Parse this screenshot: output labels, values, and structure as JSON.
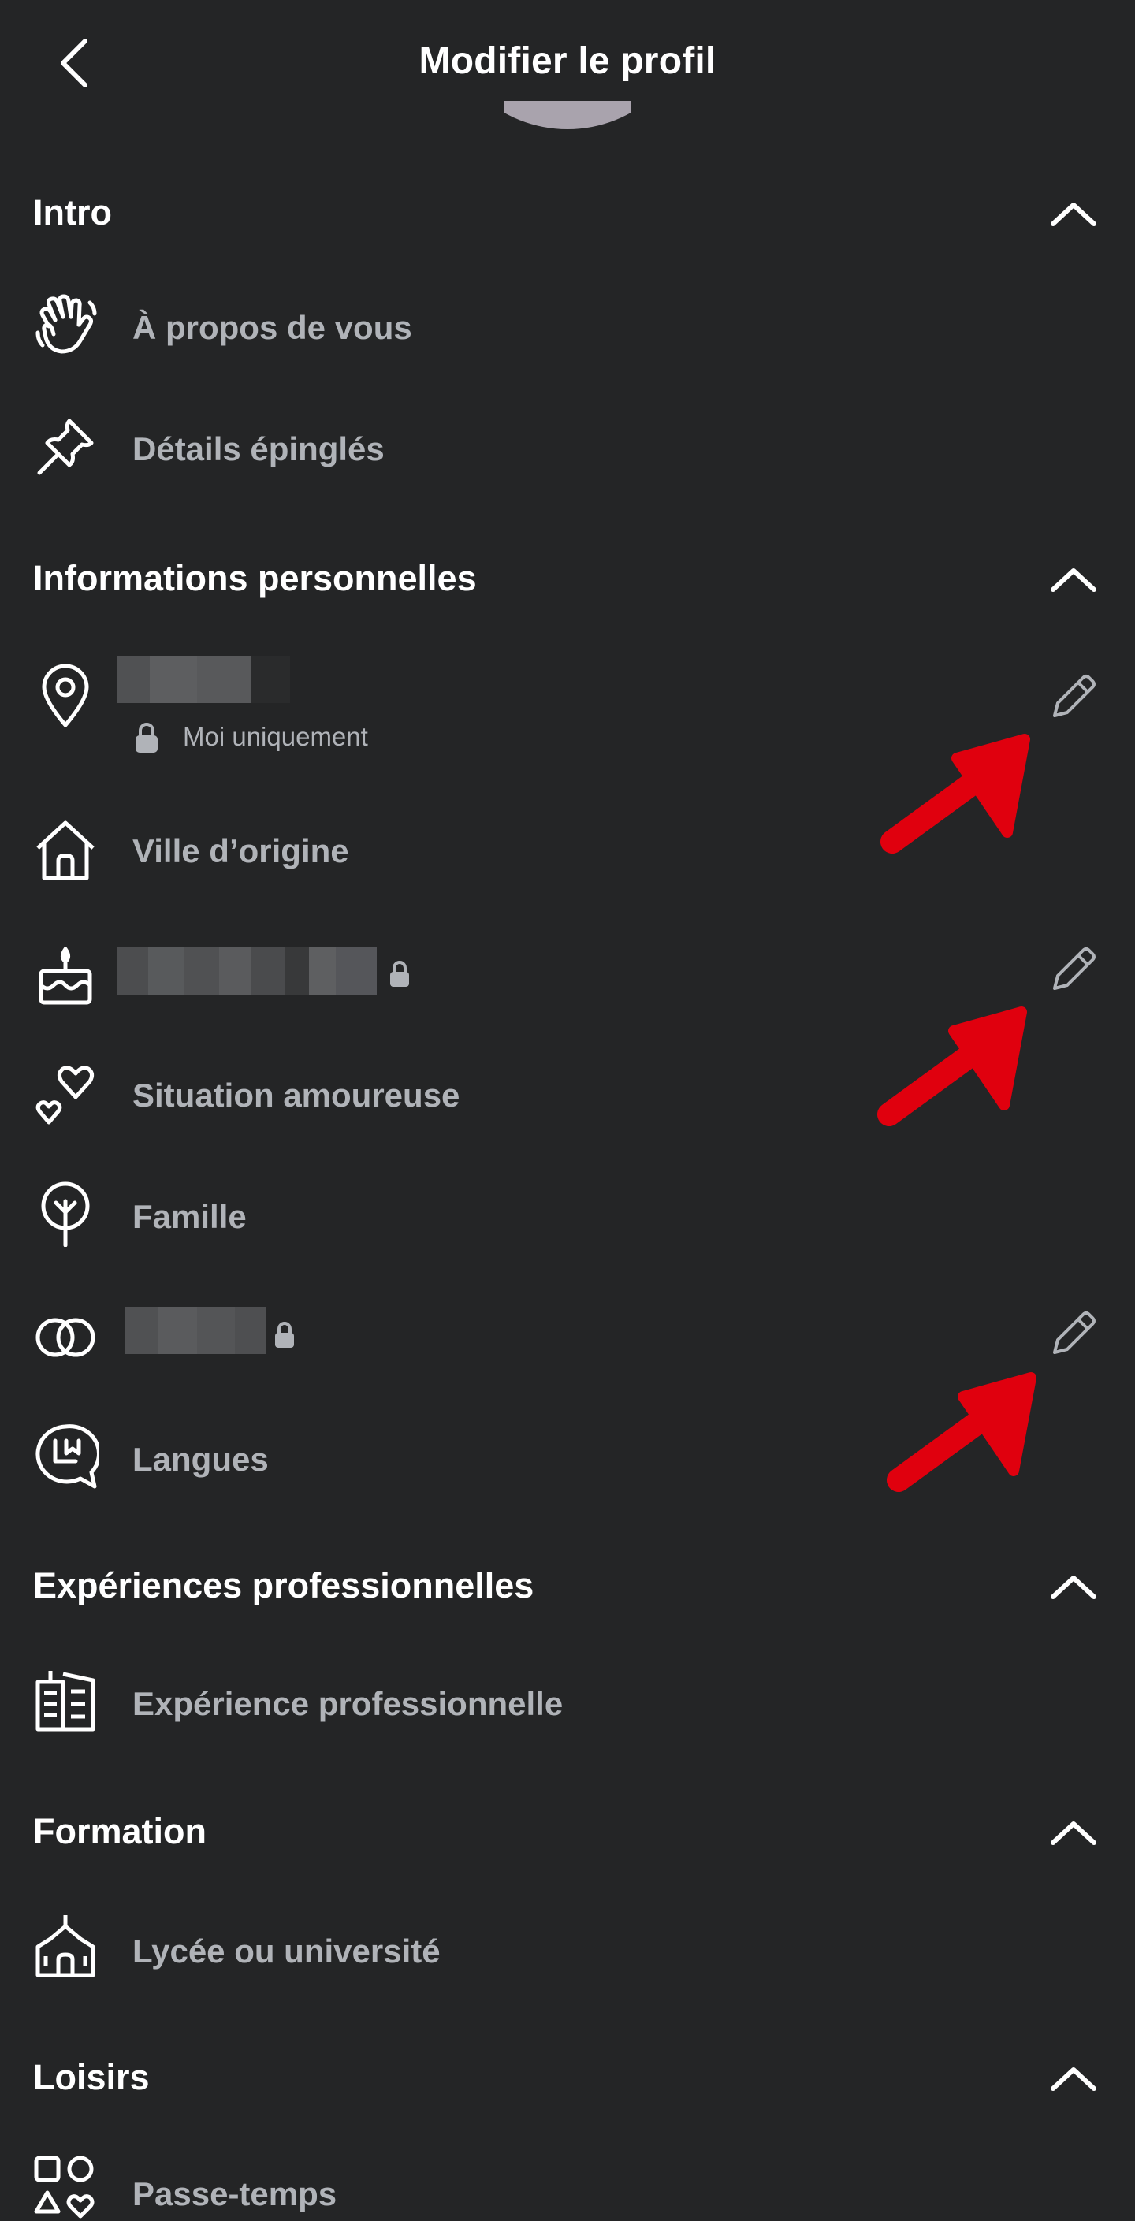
{
  "header": {
    "title": "Modifier le profil"
  },
  "icons": {
    "back": "chevron-left-icon",
    "collapse": "chevron-up-icon",
    "edit": "pencil-icon",
    "lock": "lock-icon"
  },
  "colors": {
    "background": "#242526",
    "primary_text": "#ffffff",
    "secondary_text": "#b0b3b8",
    "annotation_arrow": "#e0000e"
  },
  "sections": {
    "intro": {
      "title": "Intro",
      "items": [
        {
          "label": "À propos de vous",
          "icon": "waving-hand-icon"
        },
        {
          "label": "Détails épinglés",
          "icon": "pin-icon"
        }
      ]
    },
    "personal": {
      "title": "Informations personnelles",
      "current_city": {
        "icon": "location-pin-icon",
        "privacy": "Moi uniquement"
      },
      "hometown": {
        "label": "Ville d’origine",
        "icon": "house-icon"
      },
      "birthday": {
        "icon": "birthday-cake-icon"
      },
      "relationship": {
        "label": "Situation amoureuse",
        "icon": "hearts-icon"
      },
      "family": {
        "label": "Famille",
        "icon": "family-tree-icon"
      },
      "gender": {
        "icon": "interlocked-rings-icon"
      },
      "languages": {
        "label": "Langues",
        "icon": "speech-bubble-icon"
      }
    },
    "work": {
      "title": "Expériences professionnelles",
      "items": [
        {
          "label": "Expérience professionnelle",
          "icon": "office-building-icon"
        }
      ]
    },
    "education": {
      "title": "Formation",
      "items": [
        {
          "label": "Lycée ou université",
          "icon": "school-building-icon"
        }
      ]
    },
    "hobbies": {
      "title": "Loisirs",
      "items": [
        {
          "label": "Passe-temps",
          "icon": "shapes-icon"
        }
      ]
    }
  }
}
